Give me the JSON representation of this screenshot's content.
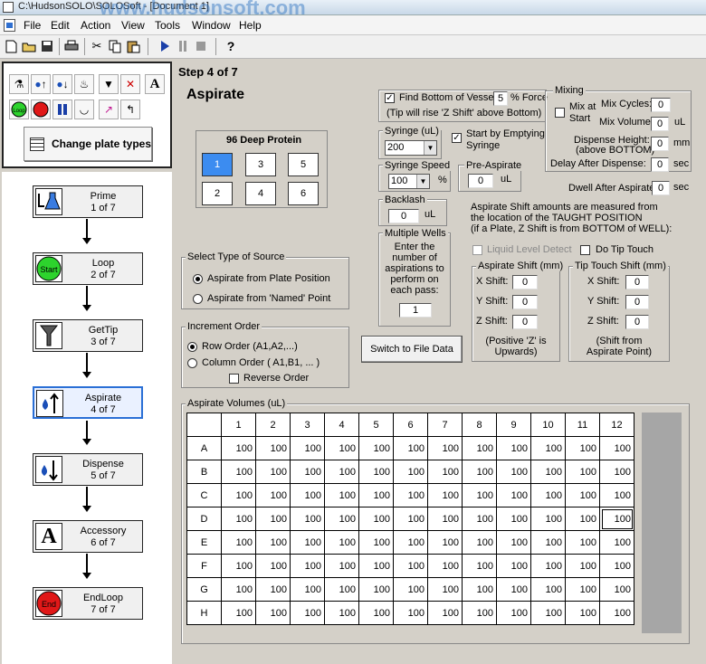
{
  "window": {
    "title": "C:\\HudsonSOLO\\SOLOSoft - [Document 1]",
    "watermark": "www.hudsonsoft.com"
  },
  "menu": [
    "File",
    "Edit",
    "Action",
    "View",
    "Tools",
    "Window",
    "Help"
  ],
  "toolbar": [
    "new",
    "open",
    "save",
    "print",
    "cut",
    "copy",
    "paste",
    "run",
    "pause",
    "stop",
    "help"
  ],
  "palette": {
    "change_plate_label": "Change plate types",
    "text_tool": "A"
  },
  "steps": [
    {
      "name": "Prime",
      "sub": "1 of 7",
      "icon": "flask-icon"
    },
    {
      "name": "Loop",
      "sub": "2 of 7",
      "icon": "start-icon",
      "icon_text": "Start"
    },
    {
      "name": "GetTip",
      "sub": "3 of 7",
      "icon": "tip-icon"
    },
    {
      "name": "Aspirate",
      "sub": "4 of 7",
      "icon": "aspirate-icon",
      "active": true
    },
    {
      "name": "Dispense",
      "sub": "5 of 7",
      "icon": "dispense-icon"
    },
    {
      "name": "Accessory",
      "sub": "6 of 7",
      "icon": "accessory-icon",
      "icon_text": "A"
    },
    {
      "name": "EndLoop",
      "sub": "7 of 7",
      "icon": "end-icon",
      "icon_text": "End"
    }
  ],
  "main": {
    "step_label": "Step 4 of 7",
    "section": "Aspirate",
    "plate": {
      "title": "96 Deep Protein",
      "wells": [
        "1",
        "3",
        "5",
        "2",
        "4",
        "6"
      ],
      "selected": "1"
    },
    "find_bottom": {
      "label": "Find Bottom of Vessel",
      "checked": true,
      "force_value": "5",
      "force_label": "% Force",
      "note": "(Tip will rise 'Z Shift' above Bottom)"
    },
    "syringe": {
      "label": "Syringe (uL)",
      "value": "200"
    },
    "start_empty": {
      "label_1": "Start by Emptying",
      "label_2": "Syringe",
      "checked": true
    },
    "syringe_speed": {
      "label": "Syringe Speed",
      "value": "100",
      "unit": "%"
    },
    "pre_aspirate": {
      "label": "Pre-Aspirate",
      "value": "0",
      "unit": "uL"
    },
    "backlash": {
      "label": "Backlash",
      "value": "0",
      "unit": "uL"
    },
    "multiple_wells": {
      "label": "Multiple Wells",
      "text": [
        "Enter the",
        "number of",
        "aspirations to",
        "perform on",
        "each pass:"
      ],
      "value": "1"
    },
    "mixing": {
      "label": "Mixing",
      "mix_at_start_1": "Mix at",
      "mix_at_start_2": "Start",
      "mix_cycles_label": "Mix Cycles:",
      "mix_cycles": "0",
      "mix_volume_label": "Mix Volume:",
      "mix_volume": "0",
      "mix_volume_unit": "uL",
      "dispense_height_label_1": "Dispense Height:",
      "dispense_height_label_2": "(above BOTTOM)",
      "dispense_height": "0",
      "dispense_height_unit": "mm",
      "delay_label": "Delay After Dispense:",
      "delay": "0",
      "delay_unit": "sec"
    },
    "dwell": {
      "label": "Dwell After Aspirate:",
      "value": "0",
      "unit": "sec"
    },
    "shift_note": [
      "Aspirate Shift amounts are measured from",
      "the location of the TAUGHT POSITION",
      "(if a Plate, Z Shift is from BOTTOM of WELL):"
    ],
    "liquid_level": {
      "label": "Liquid Level Detect",
      "checked": false
    },
    "tip_touch": {
      "label": "Do Tip Touch",
      "checked": false
    },
    "aspirate_shift": {
      "label": "Aspirate Shift (mm)",
      "x_label": "X Shift:",
      "x": "0",
      "y_label": "Y Shift:",
      "y": "0",
      "z_label": "Z Shift:",
      "z": "0",
      "note_1": "(Positive 'Z' is",
      "note_2": "Upwards)"
    },
    "tip_touch_shift": {
      "label": "Tip Touch Shift (mm)",
      "x_label": "X Shift:",
      "x": "0",
      "y_label": "Y Shift:",
      "y": "0",
      "z_label": "Z Shift:",
      "z": "0",
      "note_1": "(Shift from",
      "note_2": "Aspirate Point)"
    },
    "source": {
      "label": "Select Type of Source",
      "opt1": "Aspirate from Plate Position",
      "opt2": "Aspirate from 'Named' Point",
      "selected": "opt1"
    },
    "increment": {
      "label": "Increment Order",
      "opt1": "Row Order (A1,A2,...)",
      "opt2": "Column Order ( A1,B1, ... )",
      "reverse": "Reverse Order",
      "selected": "opt1"
    },
    "switch_button": "Switch to File Data",
    "volumes": {
      "label": "Aspirate Volumes (uL)",
      "columns": [
        "1",
        "2",
        "3",
        "4",
        "5",
        "6",
        "7",
        "8",
        "9",
        "10",
        "11",
        "12"
      ],
      "rows": [
        "A",
        "B",
        "C",
        "D",
        "E",
        "F",
        "G",
        "H"
      ],
      "value": "100"
    }
  }
}
